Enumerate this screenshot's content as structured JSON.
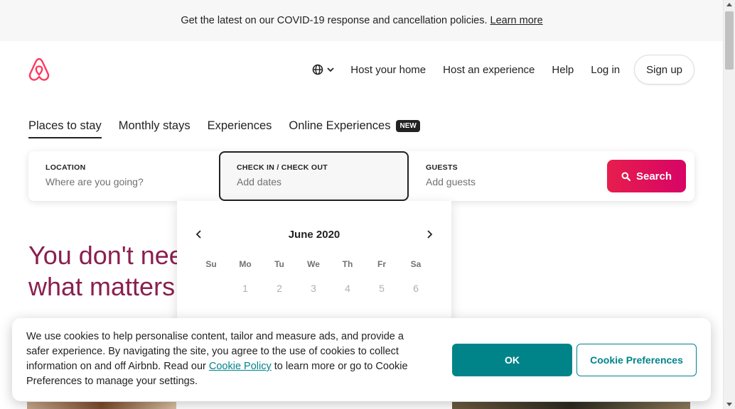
{
  "covid_banner": {
    "text": "Get the latest on our COVID-19 response and cancellation policies.",
    "link": "Learn more"
  },
  "header": {
    "logo_icon": "airbnb-logo-icon",
    "language_icon": "globe-icon",
    "nav": {
      "host_home": "Host your home",
      "host_experience": "Host an experience",
      "help": "Help",
      "login": "Log in",
      "signup": "Sign up"
    }
  },
  "tabs": {
    "places": "Places to stay",
    "monthly": "Monthly stays",
    "experiences": "Experiences",
    "online": "Online Experiences",
    "online_badge": "NEW"
  },
  "search": {
    "location_label": "LOCATION",
    "location_placeholder": "Where are you going?",
    "dates_label": "CHECK IN / CHECK OUT",
    "dates_placeholder": "Add dates",
    "guests_label": "GUESTS",
    "guests_placeholder": "Add guests",
    "button": "Search"
  },
  "hero": {
    "line1": "You don't nee",
    "line2": "what matters"
  },
  "calendar": {
    "month": "June 2020",
    "weekdays": [
      "Su",
      "Mo",
      "Tu",
      "We",
      "Th",
      "Fr",
      "Sa"
    ],
    "first_row": [
      "",
      "1",
      "2",
      "3",
      "4",
      "5",
      "6"
    ]
  },
  "cookie": {
    "text_before": "We use cookies to help personalise content, tailor and measure ads, and provide a safer experience. By navigating the site, you agree to the use of cookies to collect information on and off Airbnb. Read our ",
    "link": "Cookie Policy",
    "text_after": " to learn more or go to Cookie Preferences to manage your settings.",
    "ok": "OK",
    "preferences": "Cookie Preferences"
  },
  "colors": {
    "brand": "#FF385C",
    "search_button": "#E61E4D",
    "hero_text": "#8A1F4F",
    "teal": "#008489"
  }
}
